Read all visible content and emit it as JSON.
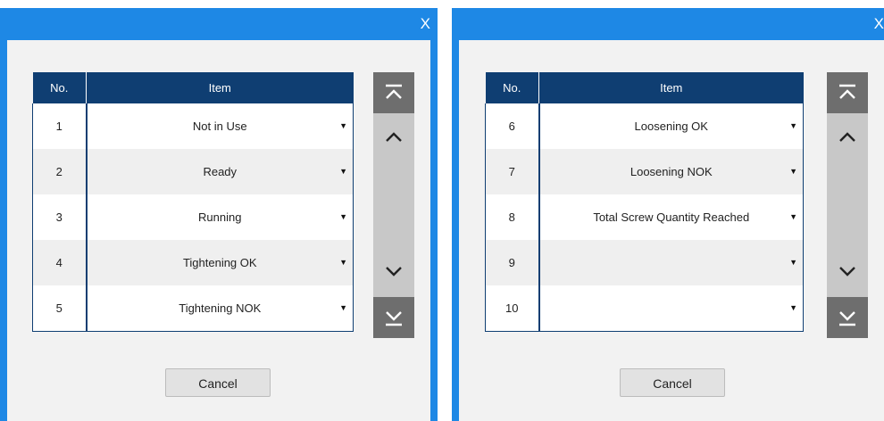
{
  "dialogs": [
    {
      "close_label": "X",
      "header": {
        "no": "No.",
        "item": "Item"
      },
      "rows": [
        {
          "no": "1",
          "item": "Not in Use"
        },
        {
          "no": "2",
          "item": "Ready"
        },
        {
          "no": "3",
          "item": "Running"
        },
        {
          "no": "4",
          "item": "Tightening OK"
        },
        {
          "no": "5",
          "item": "Tightening NOK"
        }
      ],
      "cancel_label": "Cancel"
    },
    {
      "close_label": "X",
      "header": {
        "no": "No.",
        "item": "Item"
      },
      "rows": [
        {
          "no": "6",
          "item": "Loosening OK"
        },
        {
          "no": "7",
          "item": "Loosening NOK"
        },
        {
          "no": "8",
          "item": "Total Screw Quantity Reached"
        },
        {
          "no": "9",
          "item": ""
        },
        {
          "no": "10",
          "item": ""
        }
      ],
      "cancel_label": "Cancel"
    }
  ],
  "colors": {
    "title_bar": "#1e88e5",
    "table_header": "#0f3e72",
    "panel": "#f2f2f2",
    "scrollbar": "#c8c8c8",
    "scroll_button_dark": "#6e6e6e"
  },
  "icons": {
    "scroll_top": "chevron-double-up-icon",
    "scroll_up": "chevron-up-icon",
    "scroll_down": "chevron-down-icon",
    "scroll_bottom": "chevron-double-down-icon",
    "dropdown": "caret-down-icon"
  }
}
